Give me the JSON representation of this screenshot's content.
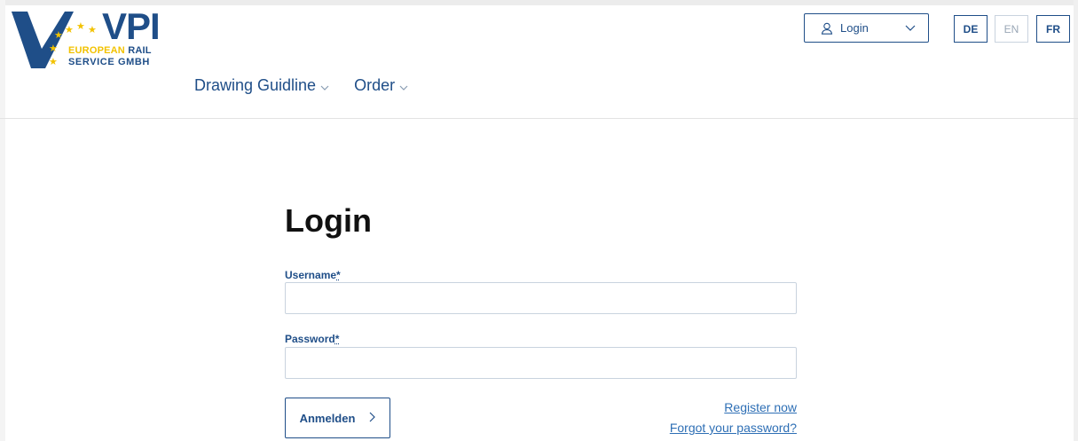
{
  "brand": {
    "name": "VPI",
    "line1_a": "EUROPEAN",
    "line1_b": "RAIL",
    "line2": "SERVICE GMBH"
  },
  "nav": {
    "items": [
      {
        "label": "Drawing Guidline"
      },
      {
        "label": "Order"
      }
    ]
  },
  "account": {
    "login_label": "Login"
  },
  "languages": [
    {
      "code": "DE",
      "active": true
    },
    {
      "code": "EN",
      "active": false
    },
    {
      "code": "FR",
      "active": true
    }
  ],
  "form": {
    "title": "Login",
    "username_label": "Username",
    "password_label": "Password",
    "required_marker": "*",
    "username_value": "",
    "password_value": "",
    "submit_label": "Anmelden",
    "register_link": "Register now",
    "forgot_link": "Forgot your password?"
  },
  "colors": {
    "brand_blue": "#1f4e88",
    "brand_yellow": "#f2c200",
    "link_blue": "#2e6fb5",
    "input_border": "#c9d3de"
  }
}
